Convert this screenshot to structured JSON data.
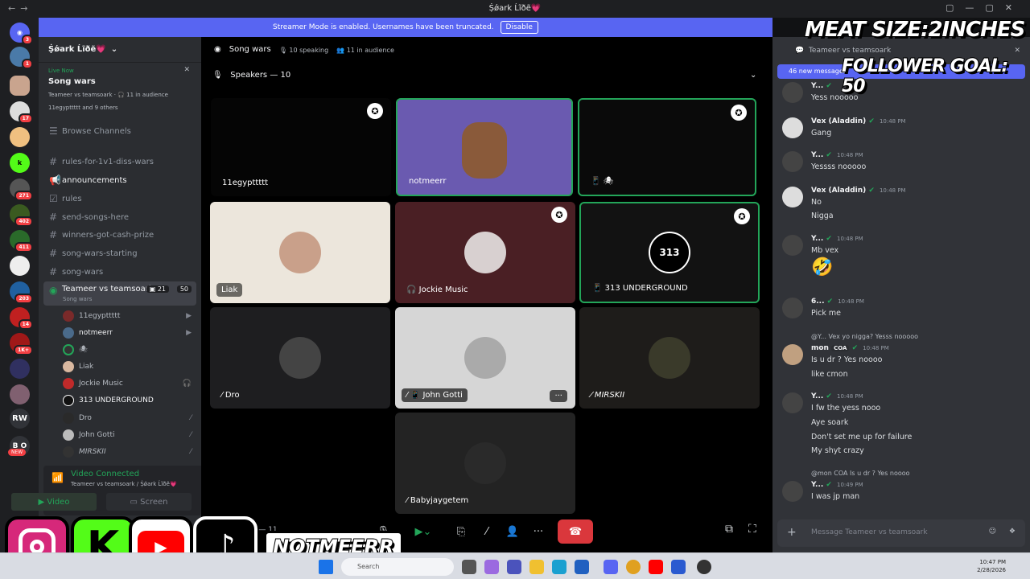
{
  "window": {
    "title": "Ṩǿark Ĺĩðẽ💗"
  },
  "banner": {
    "text": "Streamer Mode is enabled. Usernames have been truncated.",
    "button": "Disable"
  },
  "rail": {
    "badges": [
      "3",
      "1",
      "17",
      "271",
      "402",
      "411",
      "203",
      "14",
      "1K+"
    ],
    "rw": "RW",
    "new": "NEW",
    "bo": "B O"
  },
  "server": {
    "name": "Ṩǿark Ĺĩðẽ💗"
  },
  "live": {
    "tag": "Live Now",
    "title": "Song wars",
    "line1": "Teameer vs teamsoark · 🎧 11 in audience",
    "line2": "11egypttttt and 9 others"
  },
  "browse": "Browse Channels",
  "channels": [
    "rules-for-1v1-diss-wars",
    "announcements",
    "rules",
    "send-songs-here",
    "winners-got-cash-prize",
    "song-wars-starting",
    "song-wars"
  ],
  "active_channel": {
    "name": "Teameer vs teamsoark",
    "sub": "Song wars",
    "count1": "21",
    "count2": "50"
  },
  "members": [
    "11egypttttt",
    "notmeerr",
    "",
    "Liak",
    "Jockie Music",
    "313 UNDERGROUND",
    "Dro",
    "John Gotti",
    "MIRSKII"
  ],
  "voice": {
    "status": "Video Connected",
    "sub": "Teameer vs teamsoark / Ṩǿark Ĺĩðẽ💗",
    "video": "Video",
    "screen": "Screen"
  },
  "stage": {
    "title": "Song wars",
    "speaking": "10 speaking",
    "audience": "11 in audience",
    "speakers": "Speakers — 10",
    "audience_label": "ce — 11"
  },
  "tiles": [
    "11egypttttt",
    "notmeerr",
    "",
    "Liak",
    "Jockie Music",
    "313 UNDERGROUND",
    "Dro",
    "John Gotti",
    "MIRSKII",
    "Babyjaygetem"
  ],
  "chat": {
    "header": "Teameer vs teamsoark",
    "new_messages": "46 new messages",
    "composer": "Message Teameer vs teamsoark"
  },
  "messages": [
    {
      "name": "Y...",
      "time": "",
      "lines": [
        "Yess nooooo"
      ]
    },
    {
      "name": "Vex (Aladdin)",
      "time": "10:48 PM",
      "lines": [
        "Gang"
      ]
    },
    {
      "name": "Y...",
      "time": "10:48 PM",
      "lines": [
        "Yessss nooooo"
      ]
    },
    {
      "name": "Vex (Aladdin)",
      "time": "10:48 PM",
      "lines": [
        "No",
        "Nigga"
      ]
    },
    {
      "name": "Y...",
      "time": "10:48 PM",
      "lines": [
        "Mb vex",
        "🤣"
      ]
    },
    {
      "name": "6...",
      "time": "10:48 PM",
      "lines": [
        "Pick me"
      ]
    },
    {
      "name": "mon",
      "time": "10:48 PM",
      "reply": "@Y... Vex yo nigga? Yesss nooooo",
      "tag": "COA",
      "lines": [
        "Is u dr ? Yes noooo",
        "like cmon"
      ]
    },
    {
      "name": "Y...",
      "time": "10:48 PM",
      "lines": [
        "I fw the yess nooo",
        "Aye soark",
        "Don't set me up for failure",
        "My shyt crazy"
      ]
    },
    {
      "name": "Y...",
      "time": "10:49 PM",
      "reply": "@mon  COA  Is u dr ? Yes noooo",
      "lines": [
        "I was jp man"
      ]
    }
  ],
  "overlay": {
    "meat": "MEAT SIZE:2INCHES",
    "goal": "FOLLOWER GOAL: 50",
    "handle": "NOTMEERR"
  },
  "taskbar": {
    "search": "Search",
    "time": "10:47 PM",
    "date": "2/28/2026"
  }
}
